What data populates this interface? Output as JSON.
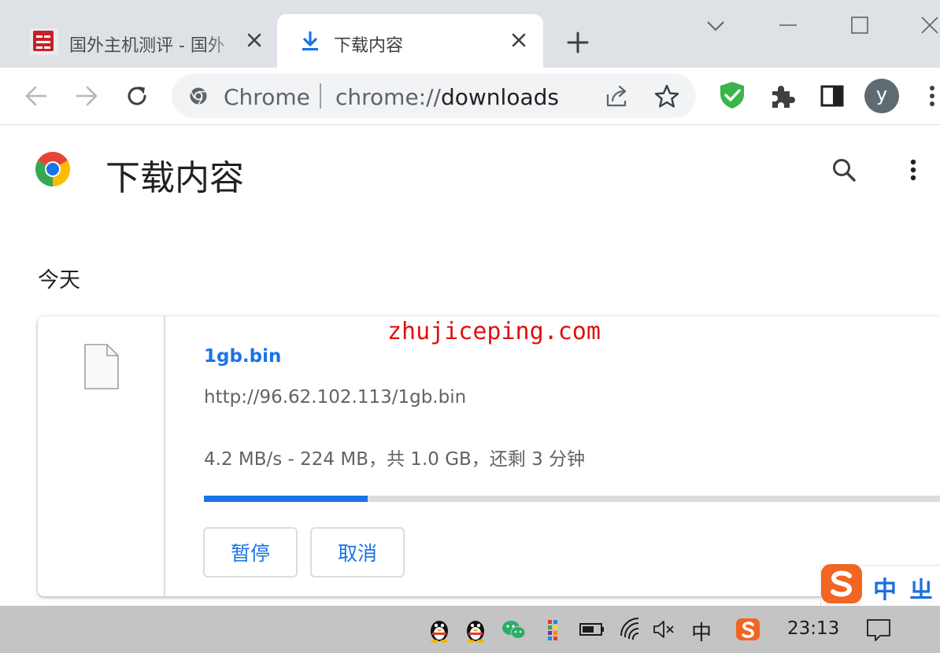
{
  "tabs": [
    {
      "title": "国外主机测评 - 国外",
      "close_icon": "close-icon",
      "favicon": "site-logo-icon",
      "active": false
    },
    {
      "title": "下载内容",
      "close_icon": "close-icon",
      "favicon": "download-arrow-icon",
      "active": true
    }
  ],
  "toolbar": {
    "omnibox_chip": "Chrome",
    "url_scheme": "chrome://",
    "url_host": "downloads",
    "avatar_letter": "y"
  },
  "page": {
    "title": "下载内容",
    "section_date": "今天"
  },
  "download": {
    "filename": "1gb.bin",
    "url": "http://96.62.102.113/1gb.bin",
    "status": "4.2 MB/s - 224 MB，共 1.0 GB，还剩 3 分钟",
    "progress_fraction": 0.21,
    "pause_label": "暂停",
    "cancel_label": "取消"
  },
  "watermark": "zhujiceping.com",
  "ime": {
    "lang_label": "中",
    "punct_label": "ㄓ"
  },
  "taskbar": {
    "ime_label": "中",
    "clock": "23:13"
  },
  "colors": {
    "accent": "#1a73e8",
    "tabstrip": "#dee1e6",
    "taskbar": "#c4c4c4",
    "watermark": "#e01010",
    "adblock": "#3ab54a",
    "sogou": "#f26522"
  }
}
